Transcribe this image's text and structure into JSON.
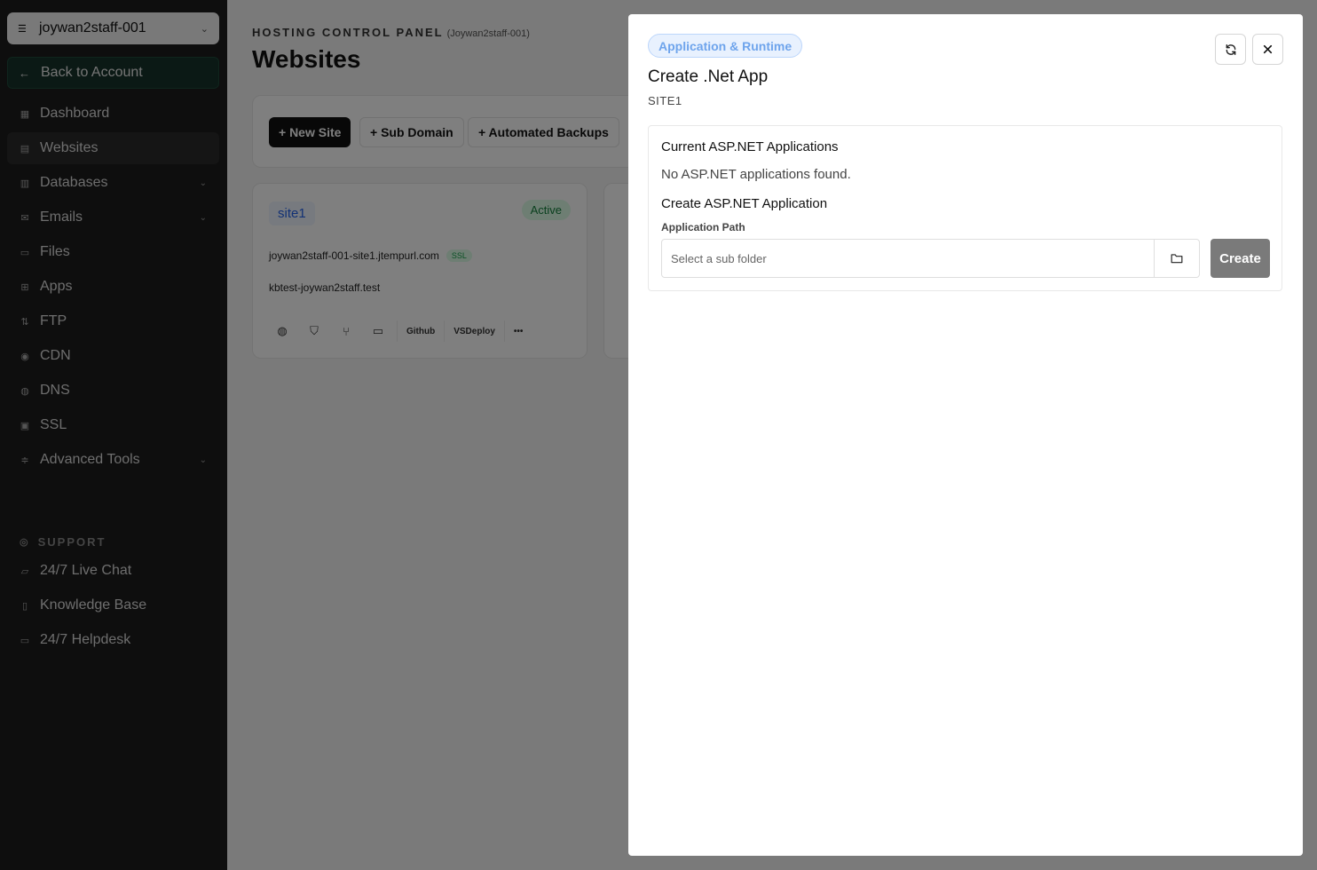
{
  "sidebar": {
    "account": "joywan2staff-001",
    "back": "Back to Account",
    "items": [
      {
        "label": "Dashboard",
        "icon": "grid-icon"
      },
      {
        "label": "Websites",
        "icon": "browser-icon"
      },
      {
        "label": "Databases",
        "icon": "database-icon"
      },
      {
        "label": "Emails",
        "icon": "mail-icon"
      },
      {
        "label": "Files",
        "icon": "folder-icon"
      },
      {
        "label": "Apps",
        "icon": "apps-icon"
      },
      {
        "label": "FTP",
        "icon": "ftp-icon"
      },
      {
        "label": "CDN",
        "icon": "cdn-icon"
      },
      {
        "label": "DNS",
        "icon": "globe-icon"
      },
      {
        "label": "SSL",
        "icon": "lock-icon"
      },
      {
        "label": "Advanced Tools",
        "icon": "sliders-icon"
      }
    ],
    "support_title": "SUPPORT",
    "support_items": [
      {
        "label": "24/7 Live Chat",
        "icon": "chat-icon"
      },
      {
        "label": "Knowledge Base",
        "icon": "book-icon"
      },
      {
        "label": "24/7 Helpdesk",
        "icon": "ticket-icon"
      }
    ]
  },
  "main": {
    "panel_label": "HOSTING CONTROL PANEL",
    "panel_account": "(Joywan2staff-001)",
    "title": "Websites",
    "toolbar": {
      "new_site": "+ New Site",
      "sub_domain": "+ Sub Domain",
      "backups": "+ Automated Backups"
    },
    "site": {
      "name": "site1",
      "status": "Active",
      "domain1": "joywan2staff-001-site1.jtempurl.com",
      "ssl": "SSL",
      "domain2": "kbtest-joywan2staff.test",
      "github": "Github",
      "vsdeploy": "VSDeploy",
      "more": "•••"
    }
  },
  "modal": {
    "badge": "Application & Runtime",
    "title": "Create .Net App",
    "subtitle": "SITE1",
    "current_heading": "Current ASP.NET Applications",
    "empty_text": "No ASP.NET applications found.",
    "create_heading": "Create ASP.NET Application",
    "path_label": "Application Path",
    "path_placeholder": "Select a sub folder",
    "path_value": "",
    "create_label": "Create"
  }
}
